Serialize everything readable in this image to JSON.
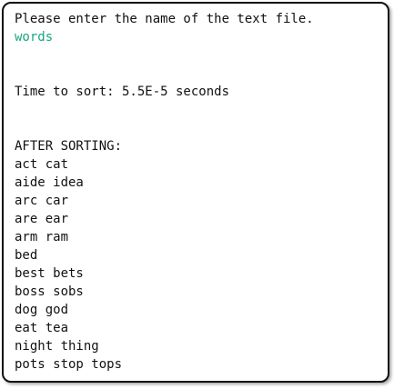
{
  "console": {
    "prompt": "Please enter the name of the text file.",
    "user_input": "words",
    "input_color": "#1aa680",
    "timing": "Time to sort: 5.5E-5 seconds",
    "results_header": "AFTER SORTING:",
    "results": [
      "act cat",
      "aide idea",
      "arc car",
      "are ear",
      "arm ram",
      "bed",
      "best bets",
      "boss sobs",
      "dog god",
      "eat tea",
      "night thing",
      "pots stop tops"
    ]
  }
}
